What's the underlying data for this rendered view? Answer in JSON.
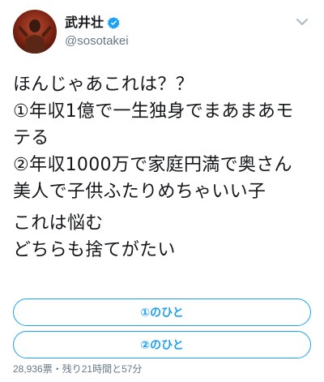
{
  "author": {
    "display_name": "武井壮",
    "handle": "@sosotakei",
    "verified_icon": "verified-badge-icon",
    "menu_icon": "chevron-down-icon"
  },
  "tweet": {
    "paragraphs": [
      [
        "ほんじゃあこれは？？",
        "①年収1億で一生独身でまあまあモ",
        "テる",
        "②年収1000万で家庭円満で奥さん",
        "美人で子供ふたりめちゃいい子"
      ],
      [
        "これは悩む",
        "どちらも捨てがたい"
      ]
    ]
  },
  "poll": {
    "options": [
      "①のひと",
      "②のひと"
    ],
    "votes": "28,936票",
    "separator": "・",
    "time_left": "残り21時間と57分"
  },
  "colors": {
    "accent": "#1da1f2",
    "secondary_text": "#657786"
  }
}
